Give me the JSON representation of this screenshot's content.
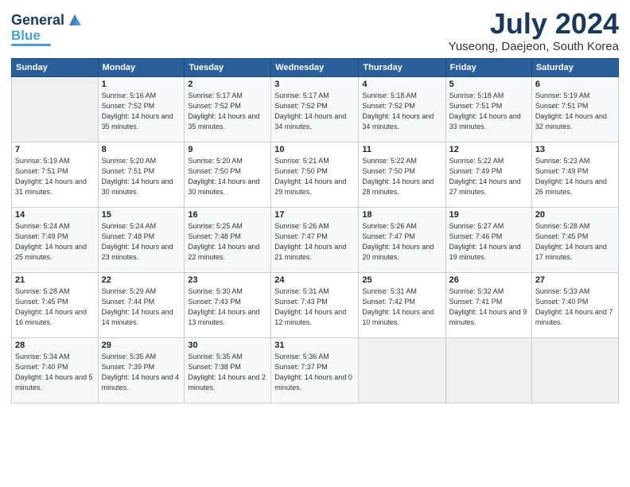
{
  "logo": {
    "general": "General",
    "blue": "Blue"
  },
  "title": "July 2024",
  "location": "Yuseong, Daejeon, South Korea",
  "headers": [
    "Sunday",
    "Monday",
    "Tuesday",
    "Wednesday",
    "Thursday",
    "Friday",
    "Saturday"
  ],
  "weeks": [
    [
      {
        "day": "",
        "sunrise": "",
        "sunset": "",
        "daylight": ""
      },
      {
        "day": "1",
        "sunrise": "Sunrise: 5:16 AM",
        "sunset": "Sunset: 7:52 PM",
        "daylight": "Daylight: 14 hours and 35 minutes."
      },
      {
        "day": "2",
        "sunrise": "Sunrise: 5:17 AM",
        "sunset": "Sunset: 7:52 PM",
        "daylight": "Daylight: 14 hours and 35 minutes."
      },
      {
        "day": "3",
        "sunrise": "Sunrise: 5:17 AM",
        "sunset": "Sunset: 7:52 PM",
        "daylight": "Daylight: 14 hours and 34 minutes."
      },
      {
        "day": "4",
        "sunrise": "Sunrise: 5:18 AM",
        "sunset": "Sunset: 7:52 PM",
        "daylight": "Daylight: 14 hours and 34 minutes."
      },
      {
        "day": "5",
        "sunrise": "Sunrise: 5:18 AM",
        "sunset": "Sunset: 7:51 PM",
        "daylight": "Daylight: 14 hours and 33 minutes."
      },
      {
        "day": "6",
        "sunrise": "Sunrise: 5:19 AM",
        "sunset": "Sunset: 7:51 PM",
        "daylight": "Daylight: 14 hours and 32 minutes."
      }
    ],
    [
      {
        "day": "7",
        "sunrise": "Sunrise: 5:19 AM",
        "sunset": "Sunset: 7:51 PM",
        "daylight": "Daylight: 14 hours and 31 minutes."
      },
      {
        "day": "8",
        "sunrise": "Sunrise: 5:20 AM",
        "sunset": "Sunset: 7:51 PM",
        "daylight": "Daylight: 14 hours and 30 minutes."
      },
      {
        "day": "9",
        "sunrise": "Sunrise: 5:20 AM",
        "sunset": "Sunset: 7:50 PM",
        "daylight": "Daylight: 14 hours and 30 minutes."
      },
      {
        "day": "10",
        "sunrise": "Sunrise: 5:21 AM",
        "sunset": "Sunset: 7:50 PM",
        "daylight": "Daylight: 14 hours and 29 minutes."
      },
      {
        "day": "11",
        "sunrise": "Sunrise: 5:22 AM",
        "sunset": "Sunset: 7:50 PM",
        "daylight": "Daylight: 14 hours and 28 minutes."
      },
      {
        "day": "12",
        "sunrise": "Sunrise: 5:22 AM",
        "sunset": "Sunset: 7:49 PM",
        "daylight": "Daylight: 14 hours and 27 minutes."
      },
      {
        "day": "13",
        "sunrise": "Sunrise: 5:23 AM",
        "sunset": "Sunset: 7:49 PM",
        "daylight": "Daylight: 14 hours and 26 minutes."
      }
    ],
    [
      {
        "day": "14",
        "sunrise": "Sunrise: 5:24 AM",
        "sunset": "Sunset: 7:49 PM",
        "daylight": "Daylight: 14 hours and 25 minutes."
      },
      {
        "day": "15",
        "sunrise": "Sunrise: 5:24 AM",
        "sunset": "Sunset: 7:48 PM",
        "daylight": "Daylight: 14 hours and 23 minutes."
      },
      {
        "day": "16",
        "sunrise": "Sunrise: 5:25 AM",
        "sunset": "Sunset: 7:48 PM",
        "daylight": "Daylight: 14 hours and 22 minutes."
      },
      {
        "day": "17",
        "sunrise": "Sunrise: 5:26 AM",
        "sunset": "Sunset: 7:47 PM",
        "daylight": "Daylight: 14 hours and 21 minutes."
      },
      {
        "day": "18",
        "sunrise": "Sunrise: 5:26 AM",
        "sunset": "Sunset: 7:47 PM",
        "daylight": "Daylight: 14 hours and 20 minutes."
      },
      {
        "day": "19",
        "sunrise": "Sunrise: 5:27 AM",
        "sunset": "Sunset: 7:46 PM",
        "daylight": "Daylight: 14 hours and 19 minutes."
      },
      {
        "day": "20",
        "sunrise": "Sunrise: 5:28 AM",
        "sunset": "Sunset: 7:45 PM",
        "daylight": "Daylight: 14 hours and 17 minutes."
      }
    ],
    [
      {
        "day": "21",
        "sunrise": "Sunrise: 5:28 AM",
        "sunset": "Sunset: 7:45 PM",
        "daylight": "Daylight: 14 hours and 16 minutes."
      },
      {
        "day": "22",
        "sunrise": "Sunrise: 5:29 AM",
        "sunset": "Sunset: 7:44 PM",
        "daylight": "Daylight: 14 hours and 14 minutes."
      },
      {
        "day": "23",
        "sunrise": "Sunrise: 5:30 AM",
        "sunset": "Sunset: 7:43 PM",
        "daylight": "Daylight: 14 hours and 13 minutes."
      },
      {
        "day": "24",
        "sunrise": "Sunrise: 5:31 AM",
        "sunset": "Sunset: 7:43 PM",
        "daylight": "Daylight: 14 hours and 12 minutes."
      },
      {
        "day": "25",
        "sunrise": "Sunrise: 5:31 AM",
        "sunset": "Sunset: 7:42 PM",
        "daylight": "Daylight: 14 hours and 10 minutes."
      },
      {
        "day": "26",
        "sunrise": "Sunrise: 5:32 AM",
        "sunset": "Sunset: 7:41 PM",
        "daylight": "Daylight: 14 hours and 9 minutes."
      },
      {
        "day": "27",
        "sunrise": "Sunrise: 5:33 AM",
        "sunset": "Sunset: 7:40 PM",
        "daylight": "Daylight: 14 hours and 7 minutes."
      }
    ],
    [
      {
        "day": "28",
        "sunrise": "Sunrise: 5:34 AM",
        "sunset": "Sunset: 7:40 PM",
        "daylight": "Daylight: 14 hours and 5 minutes."
      },
      {
        "day": "29",
        "sunrise": "Sunrise: 5:35 AM",
        "sunset": "Sunset: 7:39 PM",
        "daylight": "Daylight: 14 hours and 4 minutes."
      },
      {
        "day": "30",
        "sunrise": "Sunrise: 5:35 AM",
        "sunset": "Sunset: 7:38 PM",
        "daylight": "Daylight: 14 hours and 2 minutes."
      },
      {
        "day": "31",
        "sunrise": "Sunrise: 5:36 AM",
        "sunset": "Sunset: 7:37 PM",
        "daylight": "Daylight: 14 hours and 0 minutes."
      },
      {
        "day": "",
        "sunrise": "",
        "sunset": "",
        "daylight": ""
      },
      {
        "day": "",
        "sunrise": "",
        "sunset": "",
        "daylight": ""
      },
      {
        "day": "",
        "sunrise": "",
        "sunset": "",
        "daylight": ""
      }
    ]
  ]
}
